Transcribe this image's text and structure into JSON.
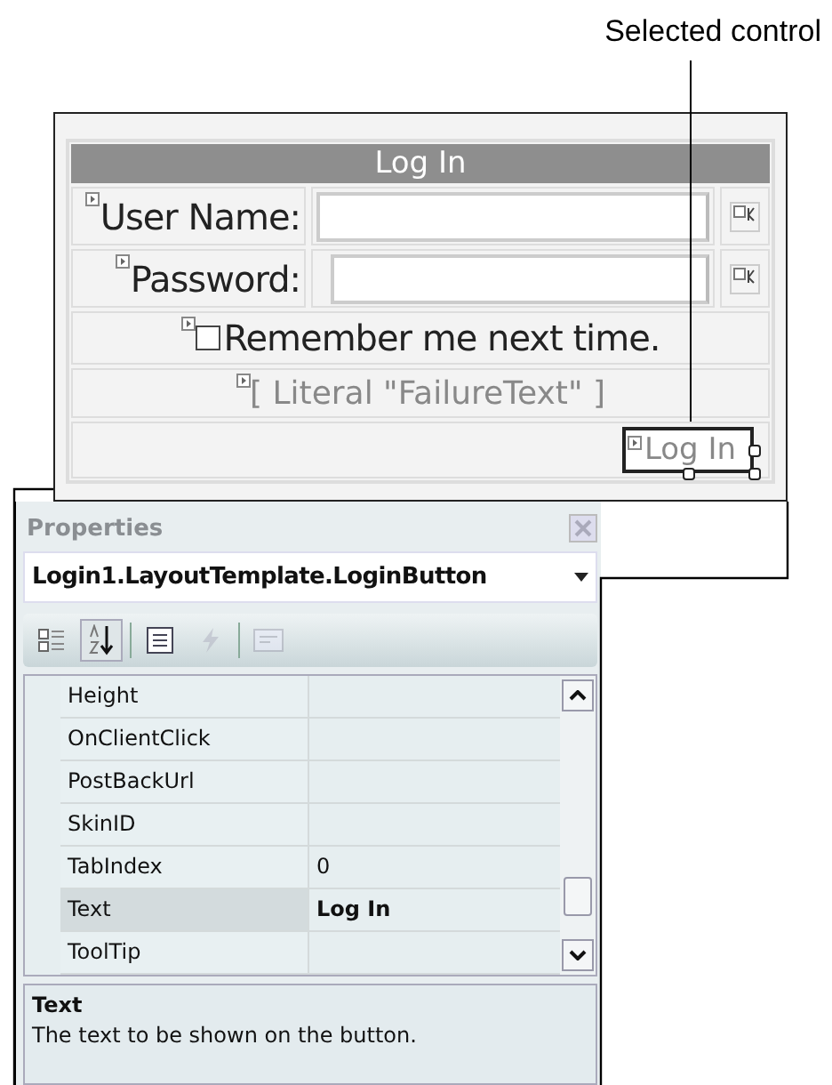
{
  "annotation": {
    "label": "Selected control"
  },
  "login_control": {
    "title": "Log In",
    "fields": [
      {
        "label": "User Name:"
      },
      {
        "label": "Password:"
      }
    ],
    "remember": {
      "label": "Remember me next time.",
      "checked": false
    },
    "failure_text": "[ Literal \"FailureText\" ]",
    "button": {
      "label": "Log In",
      "selected": true
    }
  },
  "properties": {
    "title": "Properties",
    "object": "Login1.LayoutTemplate.LoginButton",
    "toolbar": [
      {
        "kind": "categorized",
        "selected": false,
        "disabled": false
      },
      {
        "kind": "alphabetical",
        "selected": true,
        "disabled": false
      },
      {
        "kind": "properties",
        "selected": false,
        "disabled": false
      },
      {
        "kind": "events",
        "selected": false,
        "disabled": true
      },
      {
        "kind": "pages",
        "selected": false,
        "disabled": true
      }
    ],
    "rows": [
      {
        "name": "Height",
        "selected": false
      },
      {
        "name": "OnClientClick",
        "selected": false
      },
      {
        "name": "PostBackUrl",
        "selected": false
      },
      {
        "name": "SkinID",
        "selected": false
      },
      {
        "name": "TabIndex",
        "value": {
          "text": "0",
          "modified": false
        },
        "selected": false
      },
      {
        "name": "Text",
        "value": {
          "text": "Log In",
          "modified": true
        },
        "selected": true
      },
      {
        "name": "ToolTip",
        "selected": false
      }
    ],
    "description": {
      "title": "Text",
      "text": "The text to be shown on the button."
    }
  }
}
